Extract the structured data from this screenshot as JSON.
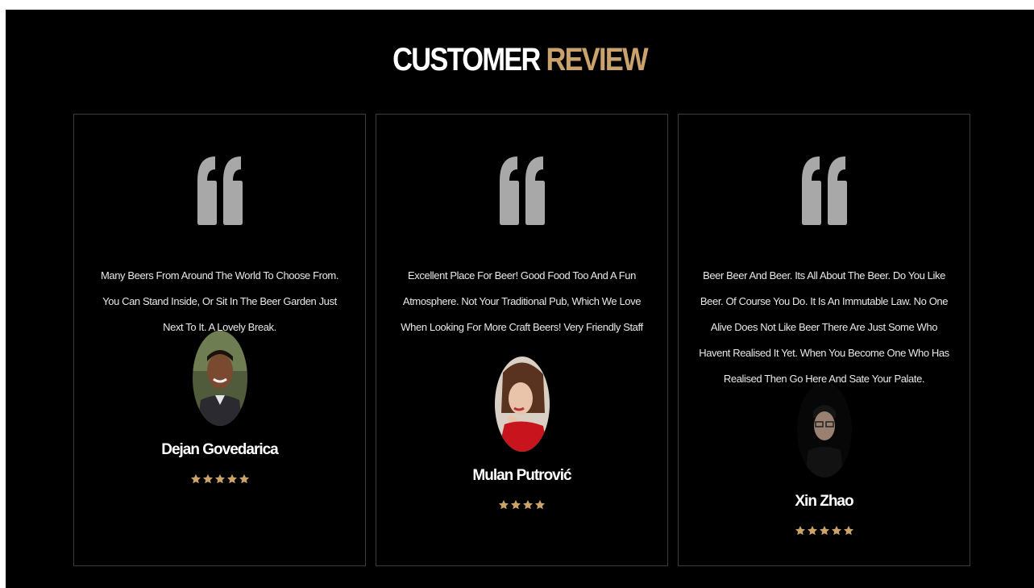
{
  "section": {
    "title_word1": "CUSTOMER",
    "title_word2": "REVIEW",
    "accent_color": "#c9a36b"
  },
  "reviews": [
    {
      "text": "Many Beers From Around The World To Choose From. You Can Stand Inside, Or Sit In The Beer Garden Just Next To It. A Lovely Break.",
      "name": "Dejan Govedarica",
      "rating": 5,
      "avatar_icon": "man-smiling-avatar"
    },
    {
      "text": "Excellent Place For Beer! Good Food Too And A Fun Atmosphere. Not Your Traditional Pub, Which We Love When Looking For More Craft Beers! Very Friendly Staff",
      "name": "Mulan Putrović",
      "rating": 4,
      "avatar_icon": "woman-red-top-avatar"
    },
    {
      "text": "Beer Beer And Beer. Its All About The Beer. Do You Like Beer. Of Course You Do. It Is An Immutable Law. No One Alive Does Not Like Beer There Are Just Some Who Havent Realised It Yet. When You Become One Who Has Realised Then Go Here And Sate Your Palate.",
      "name": "Xin Zhao",
      "rating": 5,
      "avatar_icon": "man-glasses-avatar"
    }
  ]
}
